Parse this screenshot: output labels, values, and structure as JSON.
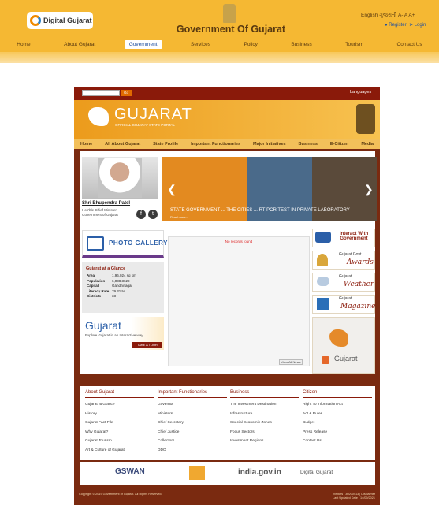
{
  "top": {
    "logo": "Digital Gujarat",
    "title": "Government Of Gujarat",
    "lang_links": "English ગુજરાતી A- A A+",
    "register": "Register",
    "login": "Login",
    "nav": [
      "Home",
      "About Gujarat",
      "Government",
      "Services",
      "Policy",
      "Business",
      "Tourism",
      "Contact Us"
    ],
    "active_nav": "Government"
  },
  "portal": {
    "search_btn": "Go",
    "languages": "Languages",
    "title": "GUJARAT",
    "subtitle": "OFFICIAL GUJARAT STATE PORTAL",
    "nav": [
      "Home",
      "All About Gujarat",
      "State Profile",
      "Important Functionaries",
      "Major Initiatives",
      "Business",
      "E-Citizen",
      "Media"
    ],
    "cm_name": "Shri Bhupendra Patel",
    "cm_desc": "Hon'ble Chief Minister, Government of Gujarat",
    "slider_caption": "STATE GOVERNMENT ... THE CITIES ... RT-PCR TEST IN PRIVATE LABORATORY",
    "slider_more": "Read more...",
    "gallery": "PHOTO GALLERY",
    "glance_title": "Gujarat at a Glance",
    "glance": [
      {
        "k": "Area",
        "v": "1,96,024 sq km"
      },
      {
        "k": "Population",
        "v": "6,038,3628"
      },
      {
        "k": "Capital",
        "v": "Gandhinagar"
      },
      {
        "k": "Literacy Rate",
        "v": "79.31 %"
      },
      {
        "k": "Districts",
        "v": "33"
      }
    ],
    "tour_title": "Gujarat",
    "tour_sub": "Explore Gujarat in an Interactive way...",
    "tour_btn": "TAKE A TOUR",
    "news_msg": "No records found",
    "news_all": "View All News",
    "right": {
      "interact": "Interact With Government",
      "awards_top": "Gujarat Govt.",
      "awards": "Awards",
      "weather_top": "Gujarat",
      "weather": "Weather",
      "magazine_top": "Gujarat",
      "magazine": "Magazine",
      "tourism": "Gujarat"
    },
    "footer": [
      {
        "h": "About Gujarat",
        "items": [
          "Gujarat at Glance",
          "History",
          "Gujarat Fact File",
          "Why Gujarat?",
          "Gujarat Tourism",
          "Art & Culture of Gujarat"
        ]
      },
      {
        "h": "Important Functionaries",
        "items": [
          "Governor",
          "Ministers",
          "Chief Secretary",
          "Chief Justice",
          "Collectors",
          "DDO"
        ]
      },
      {
        "h": "Business",
        "items": [
          "The Investment Destination",
          "Infrastructure",
          "Special Economic Zones",
          "Focus Sectors",
          "Investment Regions"
        ]
      },
      {
        "h": "Citizen",
        "items": [
          "Right To Information Act",
          "Act & Rules",
          "Budget",
          "Press Release",
          "Contact Us"
        ]
      }
    ],
    "partners": {
      "gswan": "GSWAN",
      "india": "india.gov.in",
      "dg": "Digital Gujarat"
    },
    "copyright": "Copyright © 2019 Government of Gujarat. All Rights Reserved.",
    "visitors": "Visitors : 30200413 | Disclaimer",
    "updated": "Last Updated Date : 14/09/2021"
  }
}
